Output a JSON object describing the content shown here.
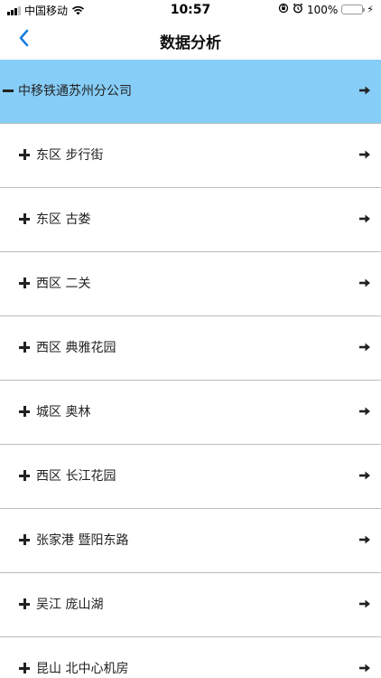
{
  "status_bar": {
    "carrier": "中国移动",
    "time": "10:57",
    "battery_percent": "100%",
    "battery_color": "#f3c400"
  },
  "nav": {
    "title": "数据分析",
    "back_icon": "chevron-left-icon",
    "accent": "#1a7fe0"
  },
  "list": {
    "selected_color": "#86cdf7",
    "items": [
      {
        "label": "中移铁通苏州分公司",
        "state": "expanded"
      },
      {
        "label": "东区 步行街",
        "state": "collapsed"
      },
      {
        "label": "东区 古娄",
        "state": "collapsed"
      },
      {
        "label": "西区 二关",
        "state": "collapsed"
      },
      {
        "label": "西区 典雅花园",
        "state": "collapsed"
      },
      {
        "label": "城区 奥林",
        "state": "collapsed"
      },
      {
        "label": "西区 长江花园",
        "state": "collapsed"
      },
      {
        "label": "张家港 暨阳东路",
        "state": "collapsed"
      },
      {
        "label": "吴江 庞山湖",
        "state": "collapsed"
      },
      {
        "label": "昆山 北中心机房",
        "state": "collapsed"
      }
    ]
  }
}
